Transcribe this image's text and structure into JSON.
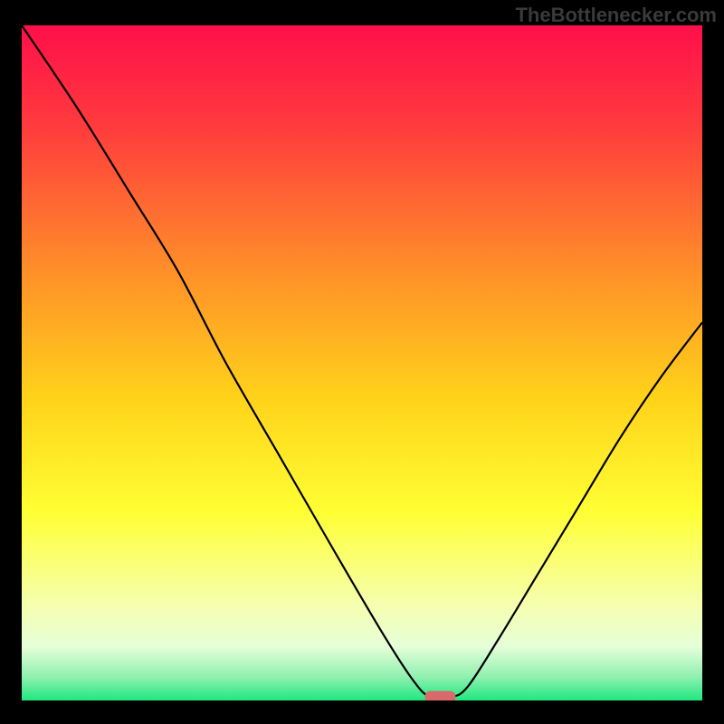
{
  "watermark": "TheBottlenecker.com",
  "chart_data": {
    "type": "line",
    "title": "",
    "xlabel": "",
    "ylabel": "",
    "xlim": [
      0,
      100
    ],
    "ylim": [
      0,
      100
    ],
    "background_gradient": {
      "stops": [
        {
          "offset": 0.0,
          "color": "#ff0f4a"
        },
        {
          "offset": 0.15,
          "color": "#ff3b3d"
        },
        {
          "offset": 0.35,
          "color": "#ff8a2a"
        },
        {
          "offset": 0.55,
          "color": "#ffd21a"
        },
        {
          "offset": 0.72,
          "color": "#ffff33"
        },
        {
          "offset": 0.86,
          "color": "#f5ffb0"
        },
        {
          "offset": 0.92,
          "color": "#e6ffd9"
        },
        {
          "offset": 0.965,
          "color": "#90f0b0"
        },
        {
          "offset": 1.0,
          "color": "#1fe87f"
        }
      ]
    },
    "curve": {
      "name": "bottleneck-curve",
      "color": "#000000",
      "points": [
        {
          "x": 0.0,
          "y": 100.0
        },
        {
          "x": 8.0,
          "y": 88.0
        },
        {
          "x": 16.0,
          "y": 75.0
        },
        {
          "x": 23.0,
          "y": 63.5
        },
        {
          "x": 30.0,
          "y": 50.0
        },
        {
          "x": 38.0,
          "y": 36.0
        },
        {
          "x": 46.0,
          "y": 22.0
        },
        {
          "x": 53.0,
          "y": 10.0
        },
        {
          "x": 57.5,
          "y": 3.0
        },
        {
          "x": 60.0,
          "y": 0.5
        },
        {
          "x": 63.0,
          "y": 0.5
        },
        {
          "x": 65.5,
          "y": 2.0
        },
        {
          "x": 70.0,
          "y": 9.0
        },
        {
          "x": 76.0,
          "y": 19.0
        },
        {
          "x": 82.0,
          "y": 29.0
        },
        {
          "x": 88.0,
          "y": 39.0
        },
        {
          "x": 94.0,
          "y": 48.0
        },
        {
          "x": 100.0,
          "y": 56.0
        }
      ]
    },
    "marker": {
      "name": "optimum-marker",
      "shape": "rounded-rect",
      "x": 61.5,
      "y": 0.5,
      "width": 4.5,
      "height": 1.8,
      "color": "#d96a6a"
    }
  }
}
